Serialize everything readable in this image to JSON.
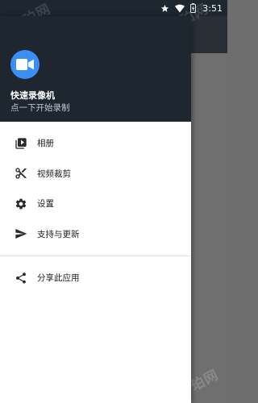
{
  "status_bar": {
    "time": "3:51",
    "icons": [
      "star-icon",
      "wifi-icon",
      "battery-charging-icon"
    ]
  },
  "drawer": {
    "header": {
      "app_icon": "video-camera-icon",
      "icon_color": "#3b8ff0",
      "app_name": "快速录像机",
      "subtitle": "点一下开始录制"
    },
    "menu": [
      {
        "label": "相册",
        "icon": "video-library-icon"
      },
      {
        "label": "视频裁剪",
        "icon": "scissors-icon"
      },
      {
        "label": "设置",
        "icon": "gear-icon"
      },
      {
        "label": "支持与更新",
        "icon": "send-icon"
      }
    ],
    "secondary_menu": [
      {
        "label": "分享此应用",
        "icon": "share-icon"
      }
    ]
  },
  "watermark": "奇珀网",
  "colors": {
    "header_bg": "#1e2630",
    "accent": "#3b8ff0",
    "icon": "#2b2b2b",
    "scrim": "#6f6f6f"
  }
}
